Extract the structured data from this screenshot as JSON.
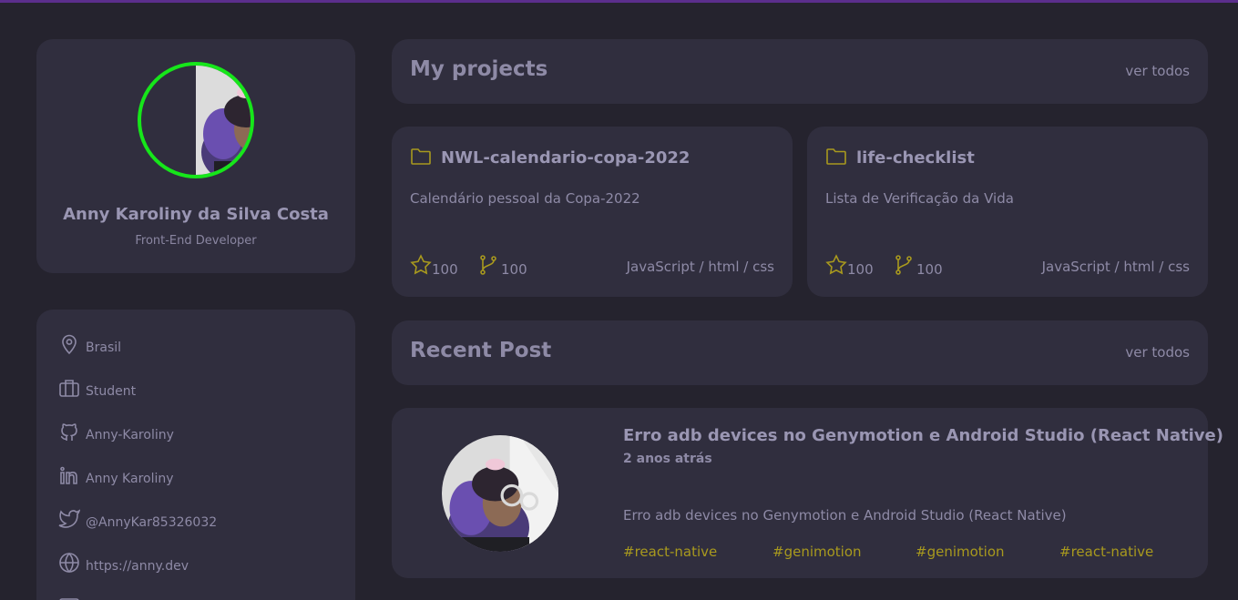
{
  "colors": {
    "background": "#25232e",
    "card": "#302e3e",
    "text": "#8e8aa6",
    "accent": "#a8991e",
    "avatar_ring": "#16e61a",
    "top_bar": "#5b2e8c"
  },
  "profile": {
    "name": "Anny Karoliny da Silva Costa",
    "role": "Front-End Developer"
  },
  "info": [
    {
      "icon": "map-pin-icon",
      "label": "Brasil"
    },
    {
      "icon": "briefcase-icon",
      "label": "Student"
    },
    {
      "icon": "github-icon",
      "label": "Anny-Karoliny"
    },
    {
      "icon": "linkedin-icon",
      "label": "Anny Karoliny"
    },
    {
      "icon": "twitter-icon",
      "label": "@AnnyKar85326032"
    },
    {
      "icon": "globe-icon",
      "label": "https://anny.dev"
    }
  ],
  "projects_section": {
    "title": "My projects",
    "see_all": "ver todos"
  },
  "projects": [
    {
      "name": "NWL-calendario-copa-2022",
      "description": "Calendário pessoal da Copa-2022",
      "stars": "100",
      "forks": "100",
      "languages": "JavaScript / html / css"
    },
    {
      "name": "life-checklist",
      "description": "Lista de Verificação da Vida",
      "stars": "100",
      "forks": "100",
      "languages": "JavaScript / html / css"
    }
  ],
  "posts_section": {
    "title": "Recent Post",
    "see_all": "ver todos"
  },
  "post": {
    "title": "Erro adb devices no Genymotion e Android Studio (React Native)",
    "date": "2 anos atrás",
    "excerpt": "Erro adb devices no Genymotion e Android Studio (React Native)",
    "tags": [
      "#react-native",
      "#genimotion",
      "#genimotion",
      "#react-native"
    ]
  }
}
